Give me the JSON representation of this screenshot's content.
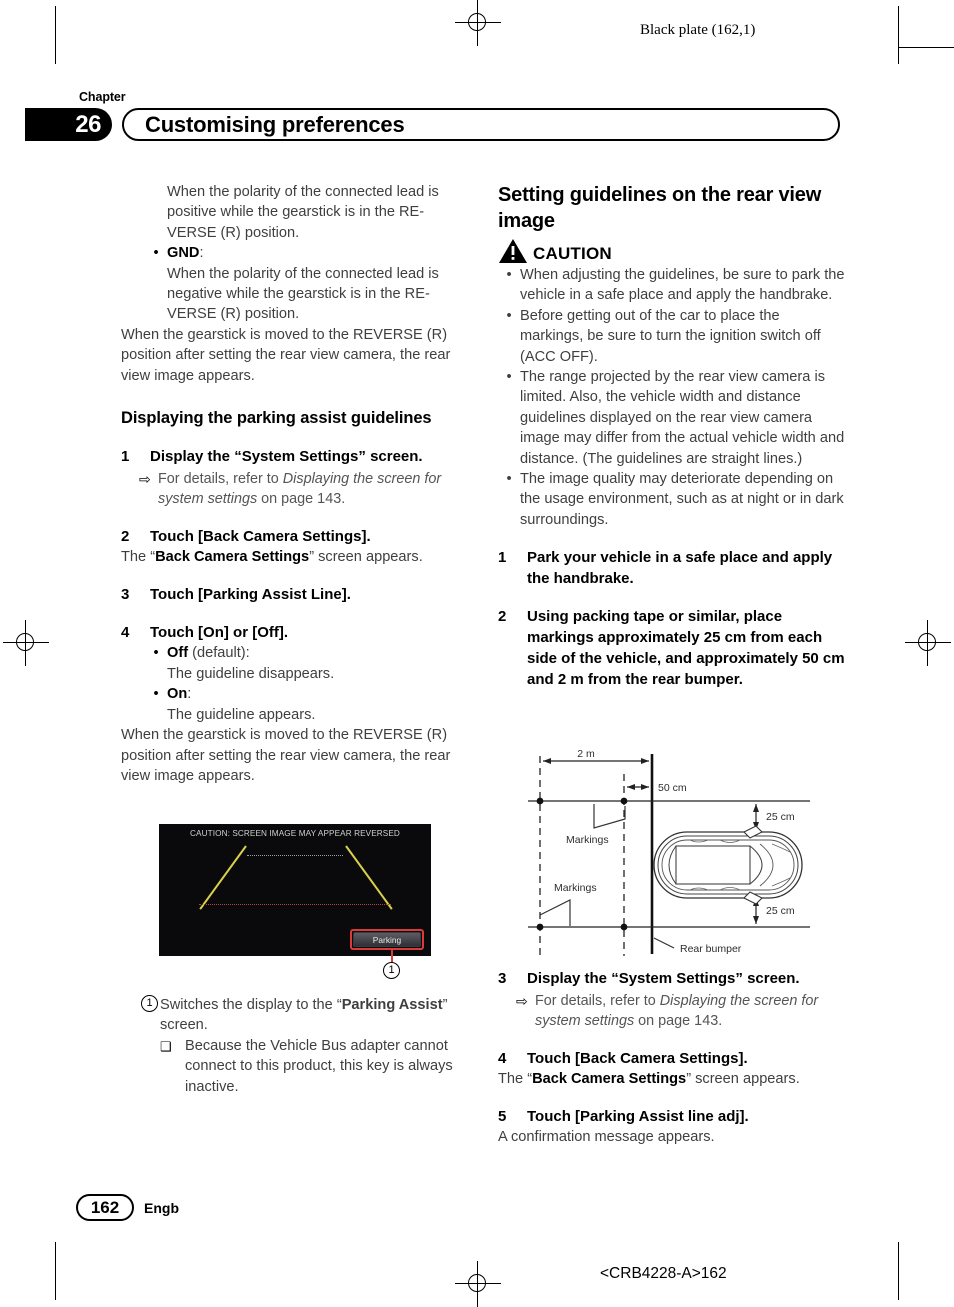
{
  "page": {
    "black_plate": "Black plate (162,1)",
    "crb_footer": "<CRB4228-A>162",
    "folio": "162",
    "language": "Engb"
  },
  "header": {
    "chapter_word": "Chapter",
    "chapter_number": "26",
    "title": "Customising preferences"
  },
  "left_column": {
    "intro_para_1": "When the polarity of the connected lead is positive while the gearstick is in the RE-VERSE (R) position.",
    "gnd_bullet_term": "GND",
    "gnd_bullet_colon": ":",
    "gnd_bullet_text": "When the polarity of the connected lead is negative while the gearstick is in the RE-VERSE (R) position.",
    "after_gnd_para": "When the gearstick is moved to the REVERSE (R) position after setting the rear view camera, the rear view image appears.",
    "section_heading": "Displaying the parking assist guidelines",
    "step1_num": "1",
    "step1_text": "Display the “System Settings” screen.",
    "step1_ref_prefix": "For details, refer to ",
    "step1_ref_italic": "Displaying the screen for system settings",
    "step1_ref_suffix": " on page 143.",
    "step2_num": "2",
    "step2_text": "Touch [Back Camera Settings].",
    "step2_after_pre": "The “",
    "step2_after_bold": "Back Camera Settings",
    "step2_after_post": "” screen appears.",
    "step3_num": "3",
    "step3_text": "Touch [Parking Assist Line].",
    "step4_num": "4",
    "step4_text": "Touch [On] or [Off].",
    "off_term": "Off",
    "off_qualifier": " (default):",
    "off_desc": "The guideline disappears.",
    "on_term": "On",
    "on_qualifier": ":",
    "on_desc": "The guideline appears.",
    "closing_para": "When the gearstick is moved to the REVERSE (R) position after setting the rear view camera, the rear view image appears.",
    "figure": {
      "caution_overlay": "CAUTION: SCREEN IMAGE MAY APPEAR REVERSED",
      "parking_key_label": "Parking",
      "callout_number": "1"
    },
    "callout": {
      "marker": "1",
      "text_pre": "Switches the display to the “",
      "text_bold": "Parking Assist",
      "text_post": "” screen.",
      "note_text": "Because the Vehicle Bus adapter cannot connect to this product, this key is always inactive."
    }
  },
  "right_column": {
    "heading": "Setting guidelines on the rear view image",
    "caution_label": "CAUTION",
    "caution_bullets": [
      "When adjusting the guidelines, be sure to park the vehicle in a safe place and apply the handbrake.",
      "Before getting out of the car to place the markings, be sure to turn the ignition switch off (ACC OFF).",
      "The range projected by the rear view camera is limited. Also, the vehicle width and distance guidelines displayed on the rear view camera image may differ from the actual vehicle width and distance. (The guidelines are straight lines.)",
      "The image quality may deteriorate depending on the usage environment, such as at night or in dark surroundings."
    ],
    "step1_num": "1",
    "step1_text": "Park your vehicle in a safe place and apply the handbrake.",
    "step2_num": "2",
    "step2_text": "Using packing tape or similar, place markings approximately 25 cm from each side of the vehicle, and approximately 50 cm and 2 m from the rear bumper.",
    "step3_num": "3",
    "step3_text": "Display the “System Settings” screen.",
    "step3_ref_prefix": "For details, refer to ",
    "step3_ref_italic": "Displaying the screen for system settings",
    "step3_ref_suffix": " on page 143.",
    "step4_num": "4",
    "step4_text": "Touch [Back Camera Settings].",
    "step4_after_pre": "The “",
    "step4_after_bold": "Back Camera Settings",
    "step4_after_post": "” screen appears.",
    "step5_num": "5",
    "step5_text": "Touch [Parking Assist line adj].",
    "step5_after": "A confirmation message appears.",
    "diagram": {
      "label_2m": "2 m",
      "label_50cm": "50 cm",
      "label_25cm_top": "25 cm",
      "label_25cm_bottom": "25 cm",
      "label_markings_top": "Markings",
      "label_markings_bottom": "Markings",
      "label_rear_bumper": "Rear bumper"
    }
  }
}
